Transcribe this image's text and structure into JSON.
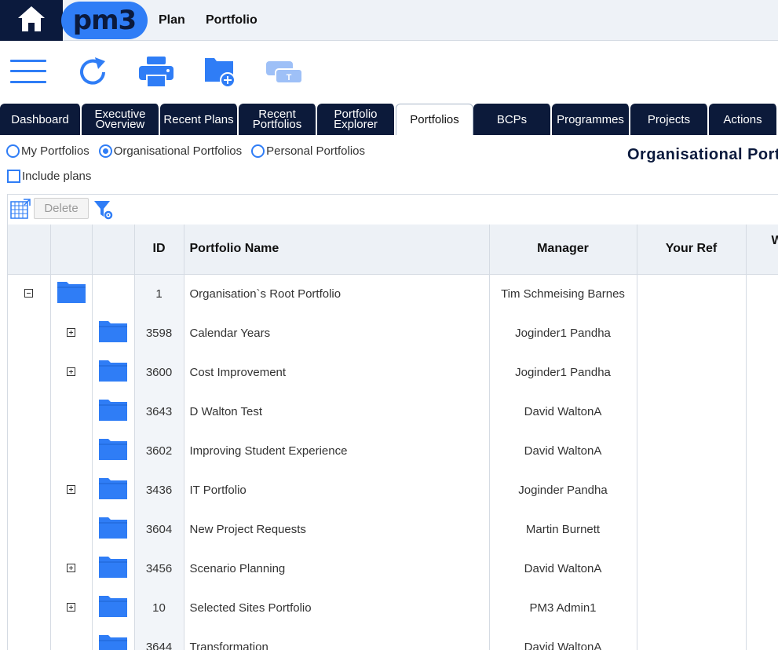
{
  "nav": {
    "logo": "pm3",
    "links": [
      "Plan",
      "Portfolio"
    ]
  },
  "tabs": [
    {
      "label": "Dashboard",
      "active": false
    },
    {
      "label": "Executive Overview",
      "active": false
    },
    {
      "label": "Recent Plans",
      "active": false
    },
    {
      "label": "Recent Portfolios",
      "active": false
    },
    {
      "label": "Portfolio Explorer",
      "active": false
    },
    {
      "label": "Portfolios",
      "active": true
    },
    {
      "label": "BCPs",
      "active": false
    },
    {
      "label": "Programmes",
      "active": false
    },
    {
      "label": "Projects",
      "active": false
    },
    {
      "label": "Actions",
      "active": false
    }
  ],
  "filters": {
    "radios": [
      {
        "label": "My Portfolios",
        "checked": false
      },
      {
        "label": "Organisational Portfolios",
        "checked": true
      },
      {
        "label": "Personal Portfolios",
        "checked": false
      }
    ],
    "include_plans": "Include plans",
    "include_plans_checked": false
  },
  "page_title": "Organisational Portfolios",
  "grid": {
    "delete_label": "Delete",
    "columns": [
      "ID",
      "Portfolio Name",
      "Manager",
      "Your Ref",
      "W"
    ],
    "rows": [
      {
        "id": "1",
        "name": "Organisation`s Root Portfolio",
        "manager": "Tim Schmeising Barnes",
        "level": 0,
        "expander": "minus"
      },
      {
        "id": "3598",
        "name": "Calendar Years",
        "manager": "Joginder1 Pandha",
        "level": 1,
        "expander": "plus"
      },
      {
        "id": "3600",
        "name": "Cost Improvement",
        "manager": "Joginder1 Pandha",
        "level": 1,
        "expander": "plus"
      },
      {
        "id": "3643",
        "name": "D Walton Test",
        "manager": "David WaltonA",
        "level": 1,
        "expander": "none"
      },
      {
        "id": "3602",
        "name": "Improving Student Experience",
        "manager": "David WaltonA",
        "level": 1,
        "expander": "none"
      },
      {
        "id": "3436",
        "name": "IT Portfolio",
        "manager": "Joginder Pandha",
        "level": 1,
        "expander": "plus"
      },
      {
        "id": "3604",
        "name": "New Project Requests",
        "manager": "Martin Burnett",
        "level": 1,
        "expander": "none"
      },
      {
        "id": "3456",
        "name": "Scenario Planning",
        "manager": "David WaltonA",
        "level": 1,
        "expander": "plus"
      },
      {
        "id": "10",
        "name": "Selected Sites Portfolio",
        "manager": "PM3 Admin1",
        "level": 1,
        "expander": "plus"
      },
      {
        "id": "3644",
        "name": "Transformation",
        "manager": "David WaltonA",
        "level": 1,
        "expander": "none"
      }
    ]
  },
  "colors": {
    "navy": "#0c1a3a",
    "accent_blue": "#2f7df6",
    "header_bg": "#edf1f6"
  }
}
